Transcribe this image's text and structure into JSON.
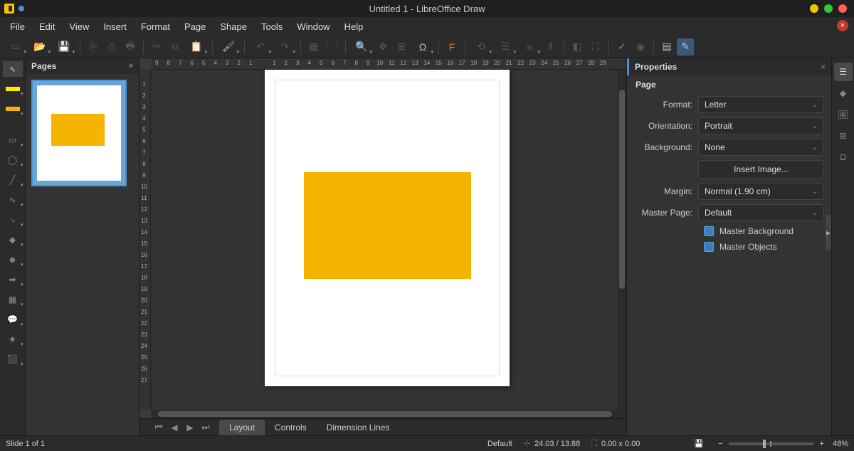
{
  "title": "Untitled 1 - LibreOffice Draw",
  "menubar": [
    "File",
    "Edit",
    "View",
    "Insert",
    "Format",
    "Page",
    "Shape",
    "Tools",
    "Window",
    "Help"
  ],
  "pages_panel": {
    "title": "Pages",
    "page_number": "1"
  },
  "properties": {
    "title": "Properties",
    "section": "Page",
    "format_label": "Format:",
    "format_value": "Letter",
    "orientation_label": "Orientation:",
    "orientation_value": "Portrait",
    "background_label": "Background:",
    "background_value": "None",
    "insert_image": "Insert Image...",
    "margin_label": "Margin:",
    "margin_value": "Normal (1.90 cm)",
    "master_page_label": "Master Page:",
    "master_page_value": "Default",
    "master_bg": "Master Background",
    "master_obj": "Master Objects"
  },
  "tabs": {
    "layout": "Layout",
    "controls": "Controls",
    "dimension": "Dimension Lines"
  },
  "status": {
    "slide": "Slide 1 of 1",
    "layer": "Default",
    "coords": "24.03 / 13.88",
    "size": "0.00 x 0.00",
    "zoom": "48%"
  },
  "ruler_h": [
    "9",
    "8",
    "7",
    "6",
    "5",
    "4",
    "3",
    "2",
    "1",
    "",
    "1",
    "2",
    "3",
    "4",
    "5",
    "6",
    "7",
    "8",
    "9",
    "10",
    "11",
    "12",
    "13",
    "14",
    "15",
    "16",
    "17",
    "18",
    "19",
    "20",
    "21",
    "22",
    "23",
    "24",
    "25",
    "26",
    "27",
    "28",
    "29"
  ],
  "ruler_v": [
    "",
    "1",
    "2",
    "3",
    "4",
    "5",
    "6",
    "7",
    "8",
    "9",
    "10",
    "11",
    "12",
    "13",
    "14",
    "15",
    "16",
    "17",
    "18",
    "19",
    "20",
    "21",
    "22",
    "23",
    "24",
    "25",
    "26",
    "27"
  ],
  "colors": {
    "fill": "#ffeb00",
    "line": "#f5b400"
  }
}
